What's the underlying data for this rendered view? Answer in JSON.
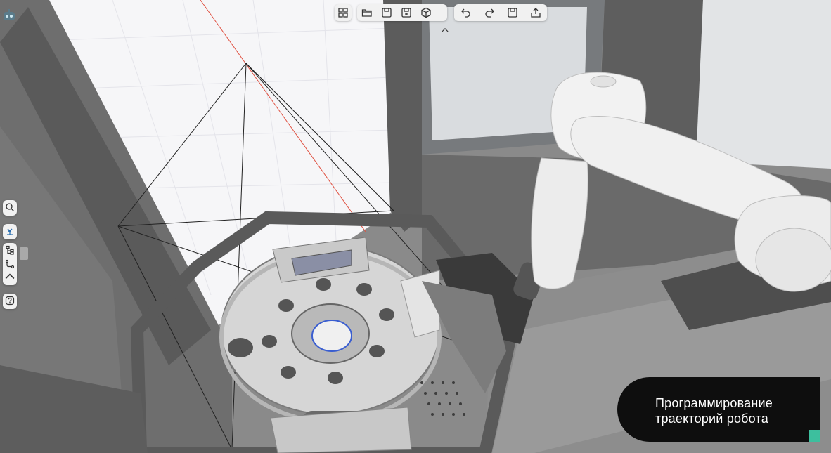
{
  "app": {
    "logo_icon": "robot-logo-icon"
  },
  "toolbar": {
    "left_group": [
      {
        "name": "layout-grid-button",
        "icon": "grid-icon"
      }
    ],
    "file_group": [
      {
        "name": "open-button",
        "icon": "folder-open-icon"
      },
      {
        "name": "save-button",
        "icon": "save-icon"
      },
      {
        "name": "save-as-button",
        "icon": "save-as-icon"
      },
      {
        "name": "object-button",
        "icon": "cube-icon"
      }
    ],
    "edit_group": [
      {
        "name": "undo-button",
        "icon": "undo-icon"
      },
      {
        "name": "redo-button",
        "icon": "redo-icon"
      },
      {
        "name": "save-alt-button",
        "icon": "save-icon"
      },
      {
        "name": "export-button",
        "icon": "upload-icon"
      }
    ],
    "collapse_icon": "chevron-up-icon"
  },
  "sidebar": {
    "search_icon": "magnifier-icon",
    "robot_icon": "robot-arm-icon",
    "tree_icon": "tree-icon",
    "path_icon": "path-icon",
    "collapse_icon": "chevron-up-icon",
    "help_icon": "help-icon"
  },
  "caption": {
    "line1": "Программирование",
    "line2": "траекторий робота"
  },
  "colors": {
    "accent": "#3dbf9e",
    "caption_bg": "#0e0e0e",
    "toolbar_bg": "#f1f1f1"
  }
}
